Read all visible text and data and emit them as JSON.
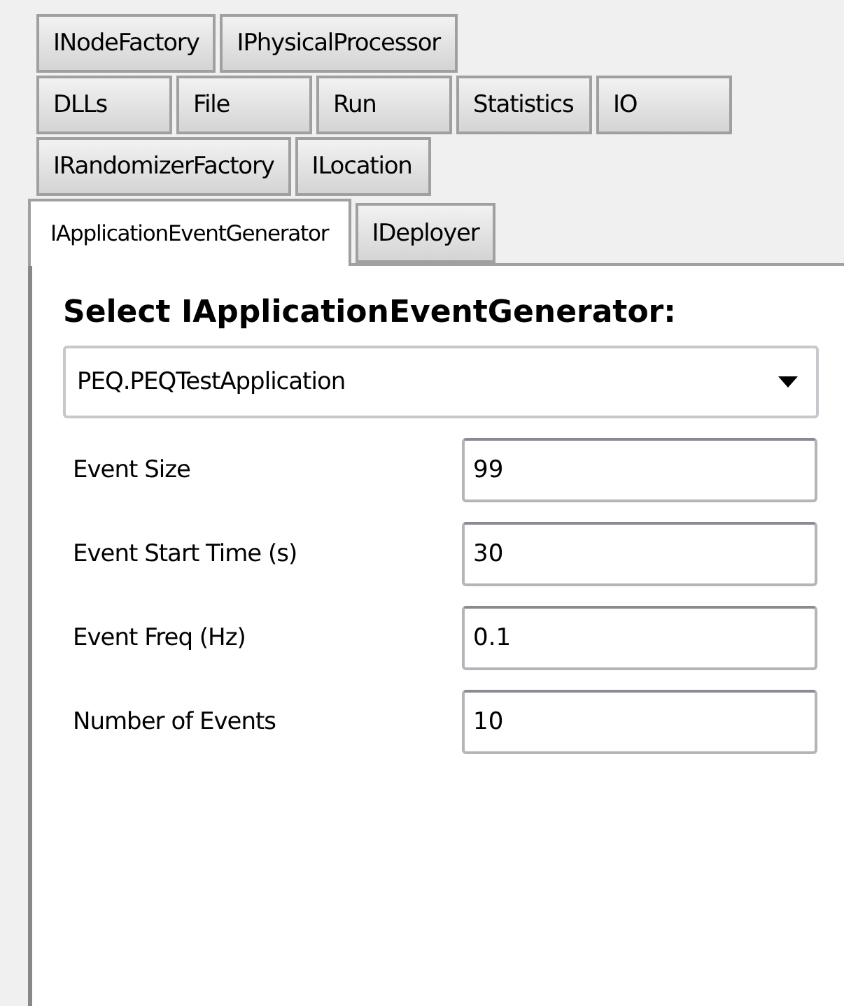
{
  "tab_rows": [
    {
      "tabs": [
        {
          "label": "INodeFactory",
          "selected": false
        },
        {
          "label": "IPhysicalProcessor",
          "selected": false
        }
      ]
    },
    {
      "tabs": [
        {
          "label": "DLLs",
          "selected": false
        },
        {
          "label": "File",
          "selected": false
        },
        {
          "label": "Run",
          "selected": false
        },
        {
          "label": "Statistics",
          "selected": false
        },
        {
          "label": "IO",
          "selected": false
        }
      ]
    },
    {
      "tabs": [
        {
          "label": "IRandomizerFactory",
          "selected": false
        },
        {
          "label": "ILocation",
          "selected": false
        }
      ]
    },
    {
      "tabs": [
        {
          "label": "IApplicationEventGenerator",
          "selected": true
        },
        {
          "label": "IDeployer",
          "selected": false
        }
      ]
    }
  ],
  "panel": {
    "heading": "Select IApplicationEventGenerator:",
    "dropdown": {
      "value": "PEQ.PEQTestApplication"
    },
    "fields": [
      {
        "label": "Event Size",
        "value": "99"
      },
      {
        "label": "Event Start Time (s)",
        "value": "30"
      },
      {
        "label": "Event Freq (Hz)",
        "value": "0.1"
      },
      {
        "label": "Number of Events",
        "value": "10"
      }
    ]
  }
}
